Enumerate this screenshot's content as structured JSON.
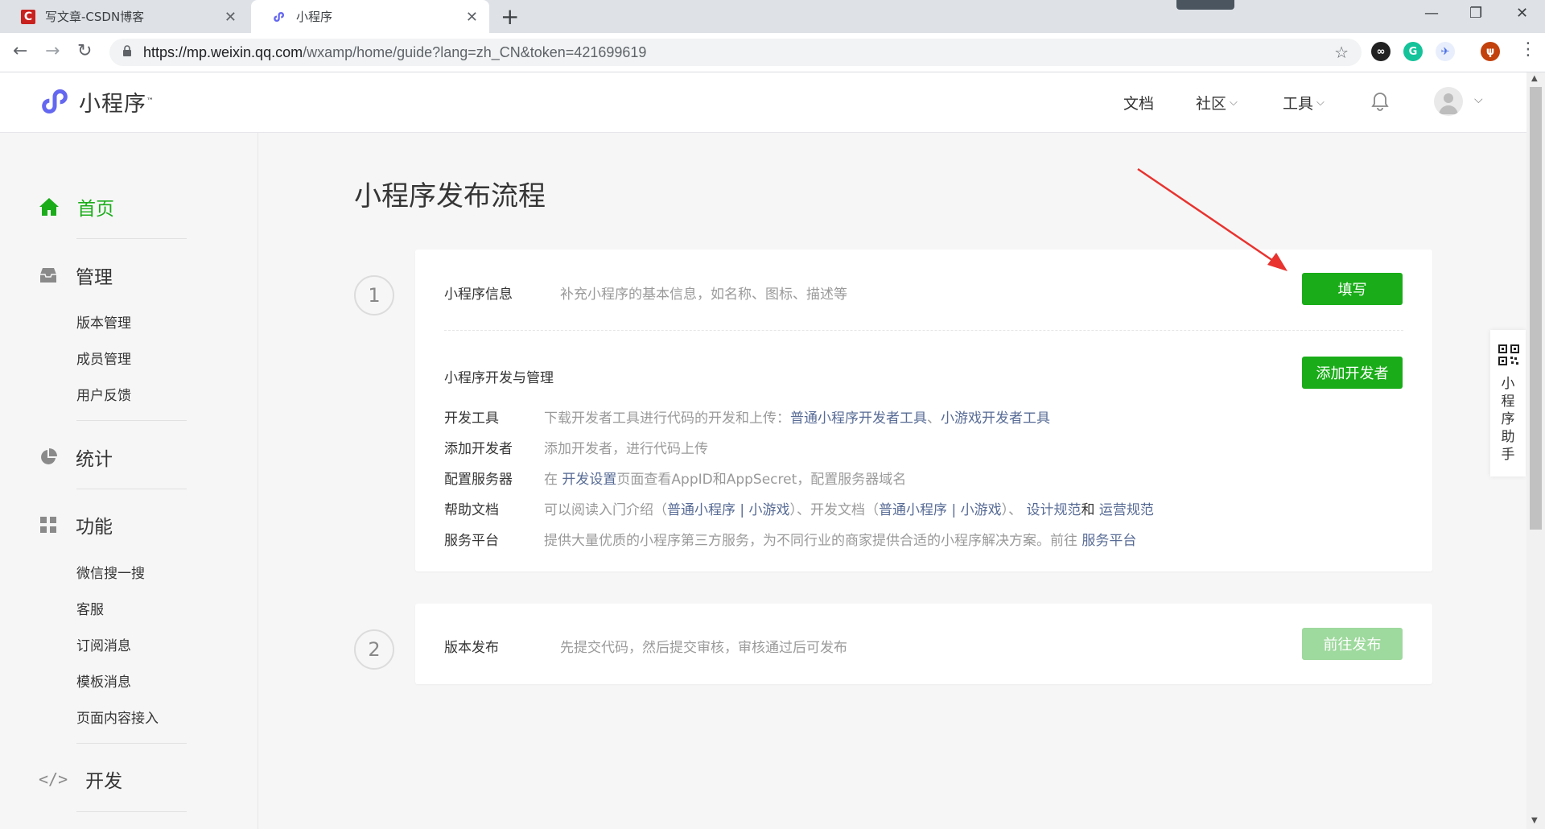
{
  "browser": {
    "tabs": [
      {
        "title": "写文章-CSDN博客",
        "favicon": "csdn-icon"
      },
      {
        "title": "小程序",
        "favicon": "miniprogram-icon"
      }
    ],
    "url_host": "https://mp.weixin.qq.com",
    "url_path": "/wxamp/home/guide?lang=zh_CN&token=421699619"
  },
  "header": {
    "logo_text": "小程序",
    "logo_tm": "™",
    "nav": {
      "docs": "文档",
      "community": "社区",
      "tools": "工具"
    }
  },
  "sidebar": {
    "home": "首页",
    "manage": "管理",
    "manage_items": [
      "版本管理",
      "成员管理",
      "用户反馈"
    ],
    "stats": "统计",
    "features": "功能",
    "feature_items": [
      "微信搜一搜",
      "客服",
      "订阅消息",
      "模板消息",
      "页面内容接入"
    ],
    "dev": "开发"
  },
  "main": {
    "title": "小程序发布流程",
    "step1": {
      "number": "1",
      "info_label": "小程序信息",
      "info_desc": "补充小程序的基本信息，如名称、图标、描述等",
      "fill_button": "填写",
      "dev_title": "小程序开发与管理",
      "add_dev_button": "添加开发者",
      "rows": {
        "tools": {
          "label": "开发工具",
          "text": "下载开发者工具进行代码的开发和上传：",
          "link1": "普通小程序开发者工具",
          "sep": "、",
          "link2": "小游戏开发者工具"
        },
        "add": {
          "label": "添加开发者",
          "text": "添加开发者，进行代码上传"
        },
        "server": {
          "label": "配置服务器",
          "pre": "在",
          "link": "开发设置",
          "post": "页面查看AppID和AppSecret，配置服务器域名"
        },
        "help": {
          "label": "帮助文档",
          "t1": "可以阅读入门介绍（",
          "l1": "普通小程序",
          "bar1": "|",
          "l2": "小游戏",
          "t2": "）、开发文档（",
          "l3": "普通小程序",
          "bar2": "|",
          "l4": "小游戏",
          "t3": "）、",
          "l5": "设计规范",
          "and": "和",
          "l6": "运营规范"
        },
        "service": {
          "label": "服务平台",
          "text": "提供大量优质的小程序第三方服务，为不同行业的商家提供合适的小程序解决方案。前往",
          "link": "服务平台"
        }
      }
    },
    "step2": {
      "number": "2",
      "label": "版本发布",
      "desc": "先提交代码，然后提交审核，审核通过后可发布",
      "button": "前往发布"
    }
  },
  "float_help": {
    "text": "小程序助手"
  },
  "colors": {
    "accent": "#1aad19",
    "link": "#576b95",
    "arrow": "#e8332f"
  }
}
